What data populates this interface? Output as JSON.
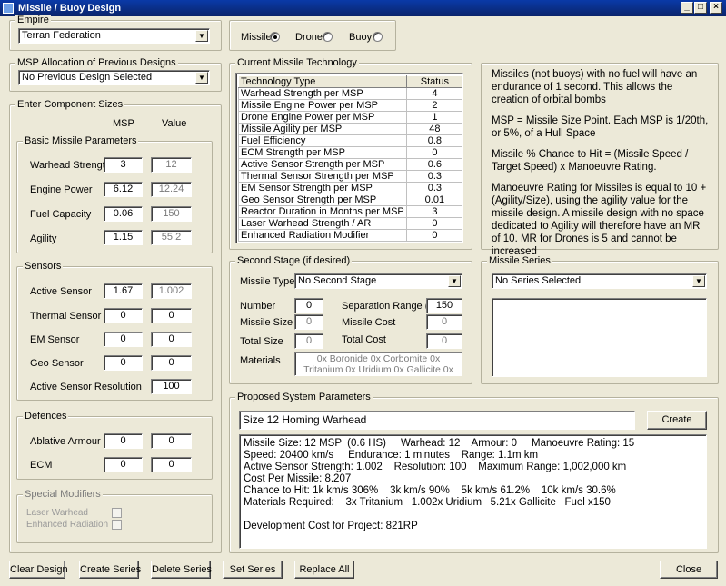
{
  "window": {
    "title": "Missile / Buoy Design"
  },
  "empire": {
    "legend": "Empire",
    "selected": "Terran Federation"
  },
  "type_selector": {
    "options": [
      {
        "label": "Missile",
        "selected": true
      },
      {
        "label": "Drone",
        "selected": false
      },
      {
        "label": "Buoy",
        "selected": false
      }
    ]
  },
  "msp_allocation": {
    "legend": "MSP Allocation of Previous Designs",
    "selected": "No Previous Design Selected"
  },
  "components": {
    "legend": "Enter Component Sizes",
    "col_msp": "MSP",
    "col_value": "Value",
    "basic": {
      "legend": "Basic Missile Parameters",
      "rows": [
        {
          "label": "Warhead Strength",
          "msp": "3",
          "value": "12"
        },
        {
          "label": "Engine Power",
          "msp": "6.12",
          "value": "12.24"
        },
        {
          "label": "Fuel Capacity",
          "msp": "0.06",
          "value": "150"
        },
        {
          "label": "Agility",
          "msp": "1.15",
          "value": "55.2"
        }
      ]
    },
    "sensors": {
      "legend": "Sensors",
      "rows": [
        {
          "label": "Active Sensor",
          "msp": "1.67",
          "value": "1.002"
        },
        {
          "label": "Thermal Sensor",
          "msp": "0",
          "value": "0"
        },
        {
          "label": "EM Sensor",
          "msp": "0",
          "value": "0"
        },
        {
          "label": "Geo Sensor",
          "msp": "0",
          "value": "0"
        }
      ],
      "resolution_label": "Active Sensor Resolution",
      "resolution_value": "100"
    },
    "defences": {
      "legend": "Defences",
      "rows": [
        {
          "label": "Ablative Armour",
          "msp": "0",
          "value": "0"
        },
        {
          "label": "ECM",
          "msp": "0",
          "value": "0"
        }
      ]
    },
    "modifiers": {
      "legend": "Special Modifiers",
      "laser_warhead": "Laser Warhead",
      "enhanced_radiation": "Enhanced Radiation"
    }
  },
  "tech": {
    "legend": "Current Missile Technology",
    "col_type": "Technology Type",
    "col_status": "Status",
    "rows": [
      {
        "type": "Warhead Strength per MSP",
        "status": "4"
      },
      {
        "type": "Missile Engine Power per MSP",
        "status": "2"
      },
      {
        "type": "Drone Engine Power per MSP",
        "status": "1"
      },
      {
        "type": "Missile Agility per MSP",
        "status": "48"
      },
      {
        "type": "Fuel Efficiency",
        "status": "0.8"
      },
      {
        "type": "ECM Strength per MSP",
        "status": "0"
      },
      {
        "type": "Active Sensor Strength per MSP",
        "status": "0.6"
      },
      {
        "type": "Thermal Sensor Strength per MSP",
        "status": "0.3"
      },
      {
        "type": "EM Sensor Strength per MSP",
        "status": "0.3"
      },
      {
        "type": "Geo Sensor Strength per MSP",
        "status": "0.01"
      },
      {
        "type": "Reactor Duration in Months per MSP",
        "status": "3"
      },
      {
        "type": "Laser Warhead Strength / AR",
        "status": "0"
      },
      {
        "type": "Enhanced Radiation Modifier",
        "status": "0"
      }
    ]
  },
  "info": {
    "p1": "Missiles (not buoys) with no fuel will have an endurance of 1 second. This allows the creation of orbital bombs",
    "p2": "MSP = Missile Size Point. Each MSP is 1/20th, or 5%, of a Hull Space",
    "p3": "Missile % Chance to Hit = (Missile Speed / Target Speed) x Manoeuvre Rating.",
    "p4": "Manoeuvre Rating for Missiles is equal to 10 + (Agility/Size), using the agility value for the missile design. A missile design with no space dedicated to Agility will therefore have an MR of 10. MR for Drones is 5 and cannot be increased"
  },
  "second_stage": {
    "legend": "Second Stage (if desired)",
    "missile_type_label": "Missile Type",
    "missile_type": "No Second Stage",
    "number_label": "Number",
    "number": "0",
    "separation_label": "Separation Range (k)",
    "separation": "150",
    "missile_size_label": "Missile Size",
    "missile_size": "0",
    "missile_cost_label": "Missile Cost",
    "missile_cost": "0",
    "total_size_label": "Total Size",
    "total_size": "0",
    "total_cost_label": "Total Cost",
    "total_cost": "0",
    "materials_label": "Materials",
    "materials_line1": "0x Boronide  0x Corbomite  0x",
    "materials_line2": "Tritanium  0x Uridium  0x Gallicite  0x"
  },
  "series": {
    "legend": "Missile Series",
    "selected": "No Series Selected"
  },
  "proposed": {
    "legend": "Proposed System Parameters",
    "name": "Size 12 Homing Warhead",
    "create_label": "Create",
    "lines": [
      "Missile Size: 12 MSP  (0.6 HS)     Warhead: 12    Armour: 0     Manoeuvre Rating: 15",
      "Speed: 20400 km/s     Endurance: 1 minutes    Range: 1.1m km",
      "Active Sensor Strength: 1.002    Resolution: 100    Maximum Range: 1,002,000 km",
      "Cost Per Missile: 8.207",
      "Chance to Hit: 1k km/s 306%    3k km/s 90%    5k km/s 61.2%    10k km/s 30.6%",
      "Materials Required:    3x Tritanium   1.002x Uridium   5.21x Gallicite   Fuel x150",
      "",
      "Development Cost for Project: 821RP"
    ]
  },
  "buttons": {
    "clear": "Clear Design",
    "create_series": "Create Series",
    "delete_series": "Delete Series",
    "set_series": "Set Series",
    "replace_all": "Replace All",
    "close": "Close"
  }
}
